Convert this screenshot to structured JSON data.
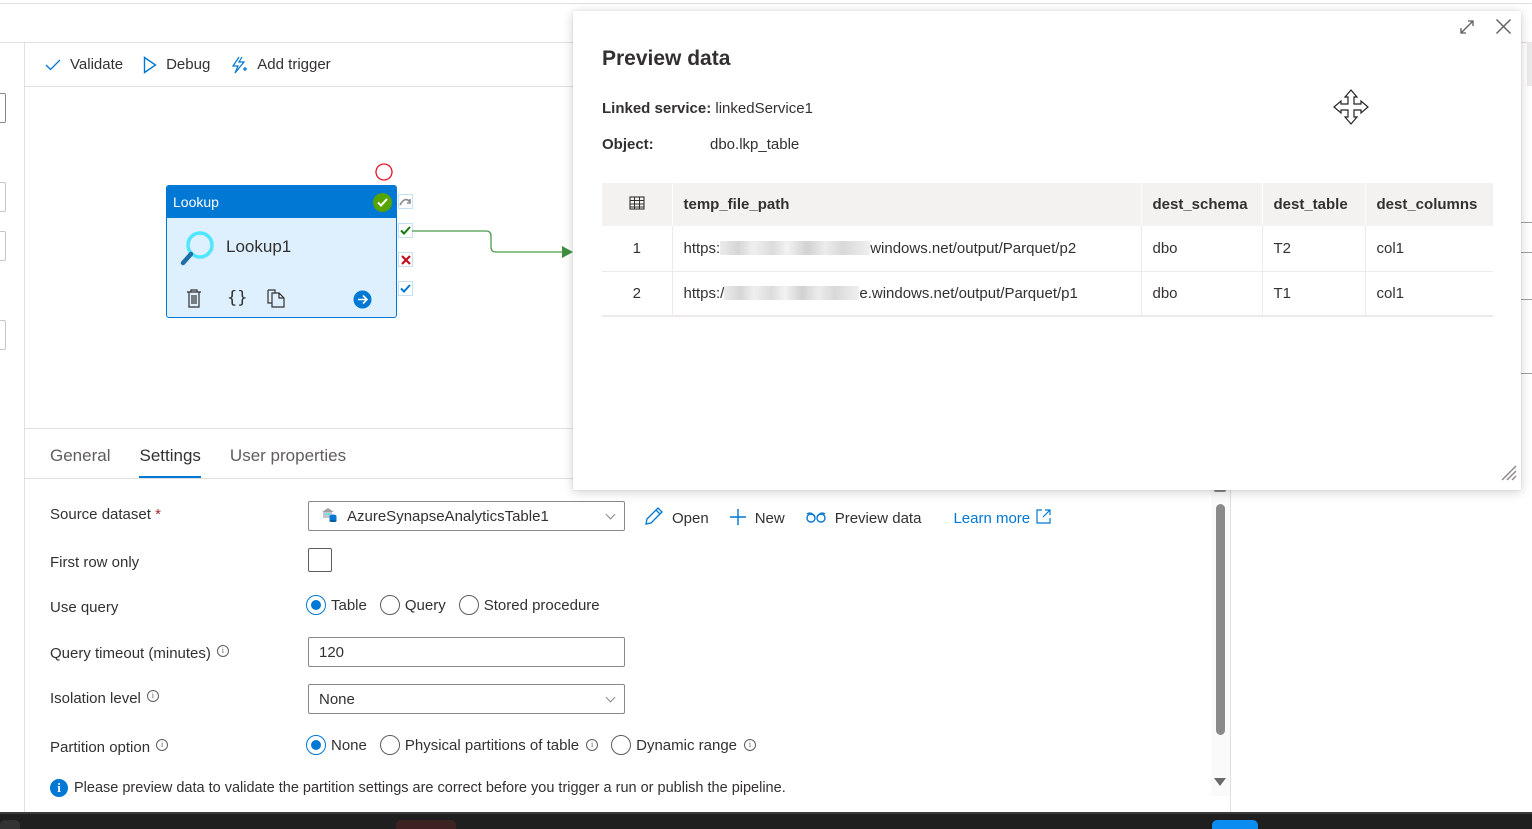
{
  "toolbar": {
    "validate_label": "Validate",
    "debug_label": "Debug",
    "add_trigger_label": "Add trigger"
  },
  "activity": {
    "type_label": "Lookup",
    "name": "Lookup1",
    "status": "succeeded",
    "colors": {
      "header": "#0078d4",
      "body": "#def0fd",
      "status": "#57a300",
      "link": "#4b9a4b"
    }
  },
  "bottom_tabs": [
    {
      "label": "General",
      "active": false
    },
    {
      "label": "Settings",
      "active": true
    },
    {
      "label": "User properties",
      "active": false
    }
  ],
  "settings": {
    "source_dataset": {
      "label": "Source dataset",
      "required_mark": "*",
      "value": "AzureSynapseAnalyticsTable1",
      "open_label": "Open",
      "new_label": "New",
      "preview_label": "Preview data",
      "learn_more_label": "Learn more"
    },
    "first_row_only": {
      "label": "First row only",
      "checked": false
    },
    "use_query": {
      "label": "Use query",
      "options": [
        "Table",
        "Query",
        "Stored procedure"
      ],
      "selected": "Table"
    },
    "query_timeout": {
      "label": "Query timeout (minutes)",
      "value": "120"
    },
    "isolation_level": {
      "label": "Isolation level",
      "value": "None"
    },
    "partition_option": {
      "label": "Partition option",
      "options": [
        "None",
        "Physical partitions of table",
        "Dynamic range"
      ],
      "selected": "None"
    },
    "notice": "Please preview data to validate the partition settings are correct before you trigger a run or publish the pipeline."
  },
  "preview": {
    "title": "Preview data",
    "linked_service_label": "Linked service:",
    "linked_service_value": "linkedService1",
    "object_label": "Object:",
    "object_value": "dbo.lkp_table",
    "columns": [
      "temp_file_path",
      "dest_schema",
      "dest_table",
      "dest_columns"
    ],
    "rows": [
      {
        "index": "1",
        "prefix": "https:",
        "suffix": "windows.net/output/Parquet/p2",
        "dest_schema": "dbo",
        "dest_table": "T2",
        "dest_columns": "col1"
      },
      {
        "index": "2",
        "prefix": "https:/",
        "suffix": "e.windows.net/output/Parquet/p1",
        "dest_schema": "dbo",
        "dest_table": "T1",
        "dest_columns": "col1"
      }
    ]
  },
  "accent_color": "#0078d4"
}
